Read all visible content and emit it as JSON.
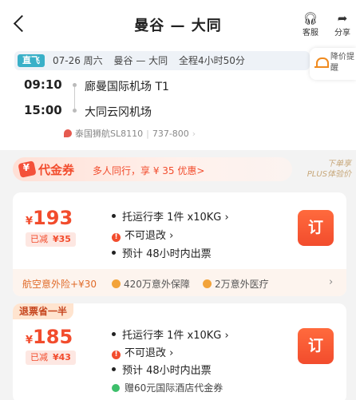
{
  "header": {
    "title": "曼谷 — 大同",
    "service_label": "客服",
    "share_label": "分享"
  },
  "flight": {
    "direct_label": "直飞",
    "date": "07-26 周六",
    "route": "曼谷 — 大同",
    "duration": "全程4小时50分",
    "depart_time": "09:10",
    "depart_airport": "廊曼国际机场 T1",
    "arrive_time": "15:00",
    "arrive_airport": "大同云冈机场",
    "airline": "泰国狮航SL8110",
    "aircraft": "737-800",
    "price_alert_label": "降价提醒"
  },
  "coupon": {
    "title": "代金券",
    "description": "多人同行，享 ¥ 35 优惠>",
    "plus_line1": "下单享",
    "plus_line2": "PLUS体验价"
  },
  "fares": [
    {
      "currency": "¥",
      "price": "193",
      "discount_label": "已减",
      "discount_value": "¥35",
      "baggage": "托运行李 1件 x10KG",
      "refund": "不可退改",
      "ticketing": "预计 48小时内出票",
      "book_label": "订",
      "insurance_title": "航空意外险+¥30",
      "insurance_item1": "420万意外保障",
      "insurance_item2": "2万意外医疗"
    },
    {
      "tag": "退票省一半",
      "currency": "¥",
      "price": "185",
      "discount_label": "已减",
      "discount_value": "¥43",
      "baggage": "托运行李 1件 x10KG",
      "refund": "不可退改",
      "ticketing": "预计 48小时内出票",
      "gift": "赠60元国际酒店代金券",
      "book_label": "订"
    }
  ],
  "colors": {
    "accent": "#f24c2d",
    "direct_badge": "#3ab0c8",
    "alert_bell": "#f08a1e"
  }
}
